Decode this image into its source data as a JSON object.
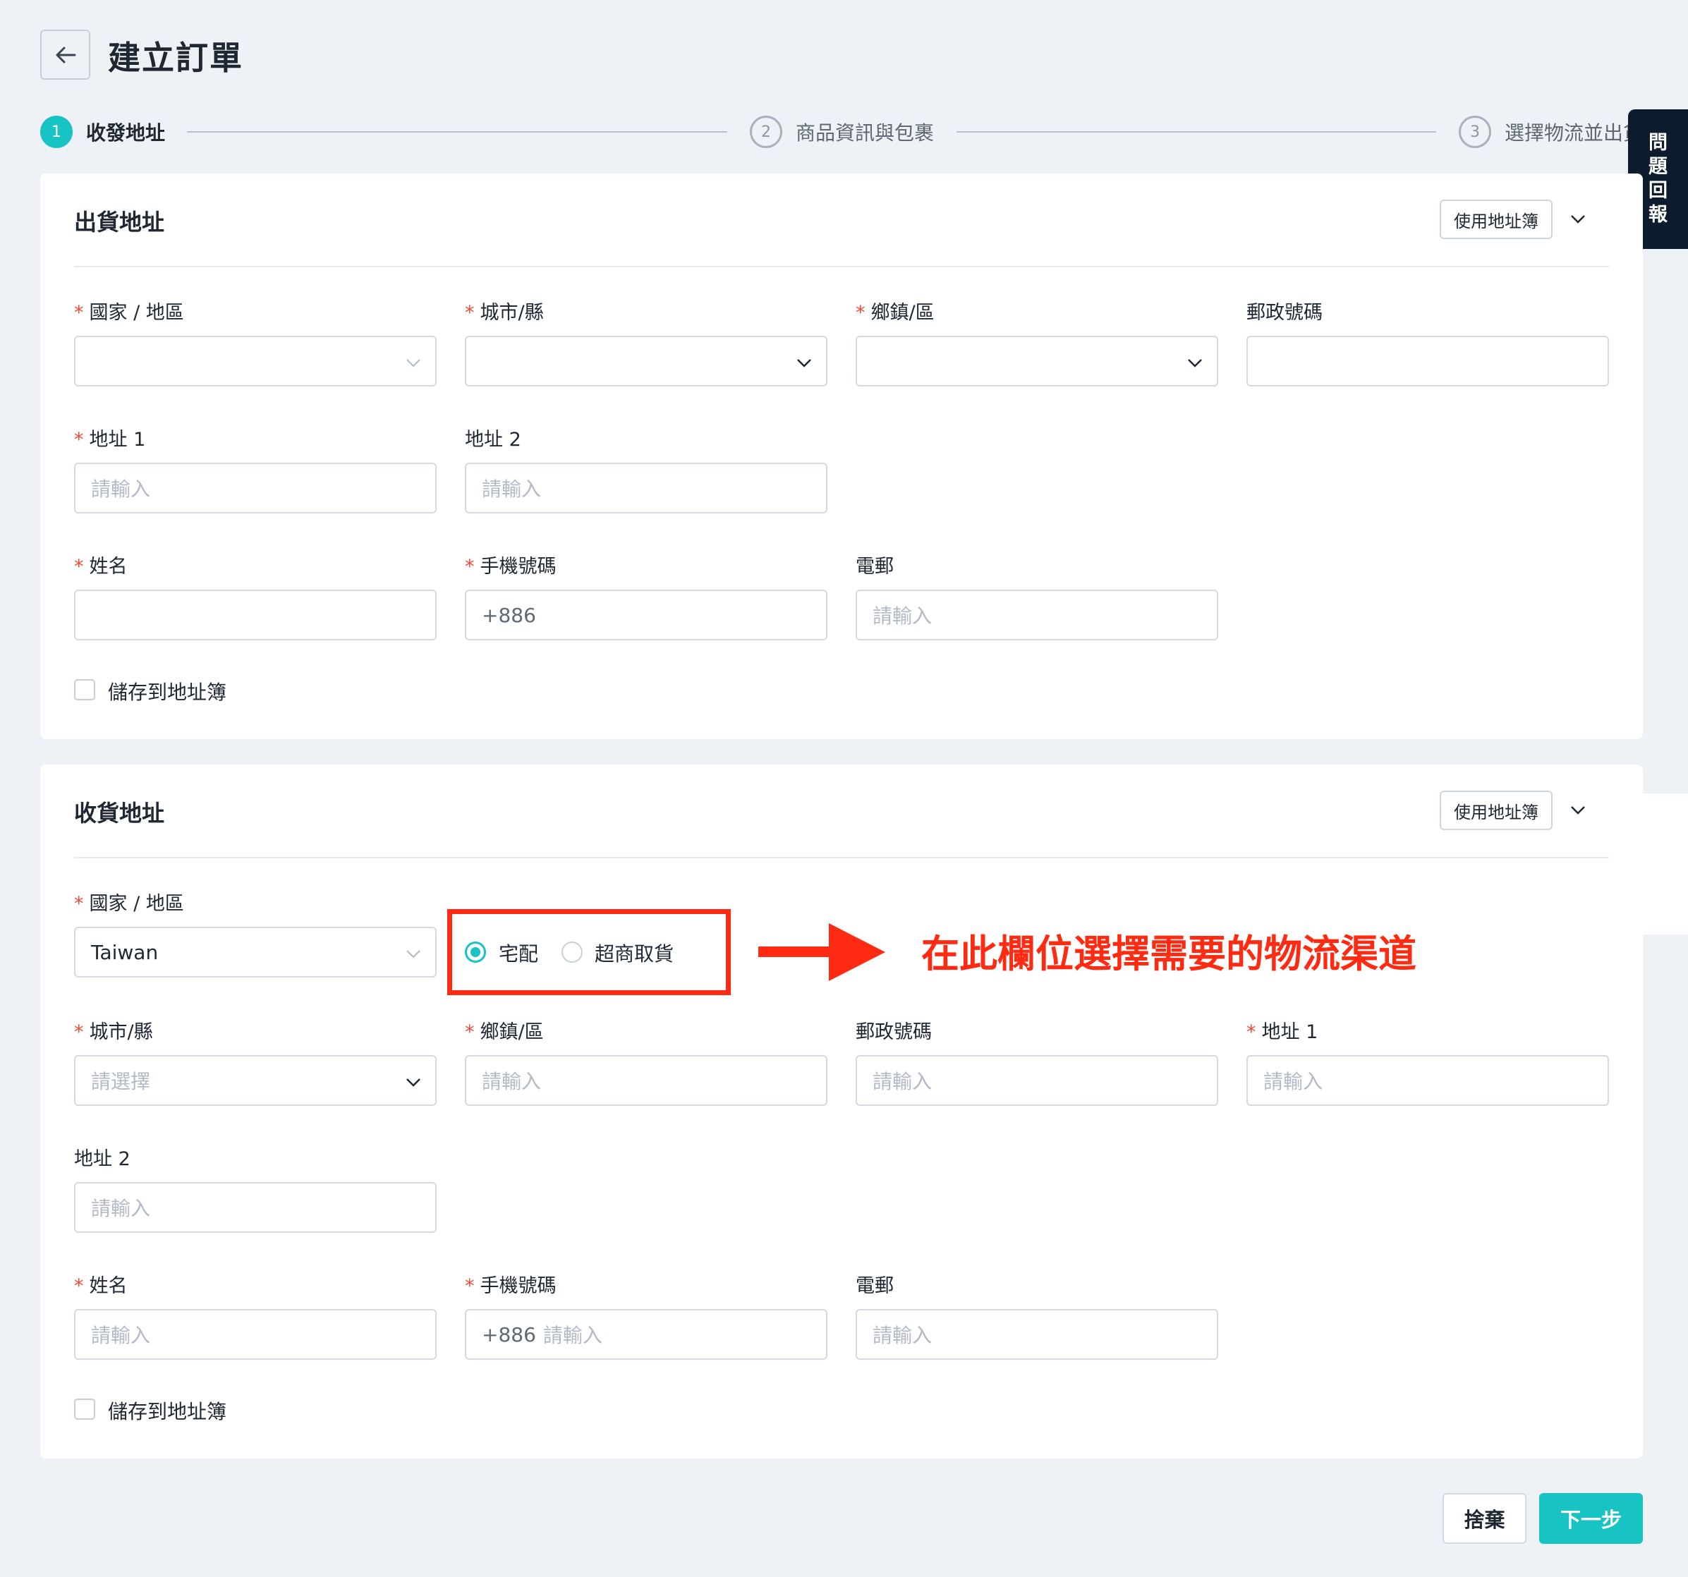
{
  "header": {
    "title": "建立訂單"
  },
  "stepper": [
    {
      "num": "1",
      "label": "收發地址"
    },
    {
      "num": "2",
      "label": "商品資訊與包裹"
    },
    {
      "num": "3",
      "label": "選擇物流並出貨"
    }
  ],
  "side_tab": {
    "chars": [
      "問",
      "題",
      "回",
      "報"
    ]
  },
  "sender": {
    "title": "出貨地址",
    "addressbook_label": "使用地址簿",
    "country_label": "國家 / 地區",
    "city_label": "城市/縣",
    "district_label": "鄉鎮/區",
    "postal_label": "郵政號碼",
    "address1_label": "地址 1",
    "address1_placeholder": "請輸入",
    "address2_label": "地址 2",
    "address2_placeholder": "請輸入",
    "name_label": "姓名",
    "phone_label": "手機號碼",
    "phone_value": "+886",
    "email_label": "電郵",
    "email_placeholder": "請輸入",
    "save_label": "儲存到地址簿"
  },
  "receiver": {
    "title": "收貨地址",
    "addressbook_label": "使用地址簿",
    "country_label": "國家 / 地區",
    "country_value": "Taiwan",
    "delivery_options": [
      "宅配",
      "超商取貨"
    ],
    "city_label": "城市/縣",
    "city_placeholder": "請選擇",
    "district_label": "鄉鎮/區",
    "district_placeholder": "請輸入",
    "postal_label": "郵政號碼",
    "postal_placeholder": "請輸入",
    "address1_label": "地址 1",
    "address1_placeholder": "請輸入",
    "address2_label": "地址 2",
    "address2_placeholder": "請輸入",
    "name_label": "姓名",
    "name_placeholder": "請輸入",
    "phone_label": "手機號碼",
    "phone_prefix": "+886",
    "phone_placeholder": "請輸入",
    "email_label": "電郵",
    "email_placeholder": "請輸入",
    "save_label": "儲存到地址簿"
  },
  "annotation": {
    "text": "在此欄位選擇需要的物流渠道"
  },
  "footer": {
    "discard_label": "捨棄",
    "next_label": "下一步"
  },
  "colors": {
    "accent": "#17c3c3",
    "annotation": "#ff2a12",
    "required": "#f04a3a",
    "side_tab_bg": "#0d1b2e"
  }
}
